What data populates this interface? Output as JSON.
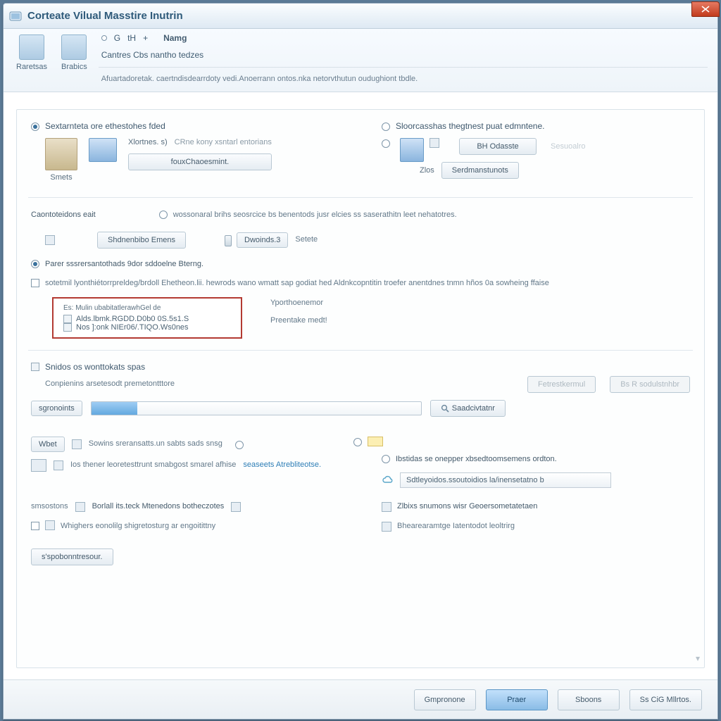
{
  "window": {
    "title": "Corteate Vilual Masstire Inutrin"
  },
  "close_btn_icon": "close-icon",
  "ribbon": {
    "tab1_label": "Raretsas",
    "tab2_label": "Brabics",
    "mini_items": [
      "●",
      "G",
      "tH",
      "+"
    ],
    "right_heading": "Namg",
    "subhead": "Cantres   Cbs  nantho tedzes",
    "desc": "Afuartadoretak. caertndisdearrdoty vedi.Anoerrann ontos.nka netorvthutun oudughiont tbdle."
  },
  "section1": {
    "left_radio": "Sextarnteta ore ethestohes fded",
    "right_radio": "Sloorcasshas thegtnest puat edmntene.",
    "left_field1": "Xlortnes. s)",
    "left_field1_hint": "CRne kony xsntarl entorians",
    "left_button": "fouxChaoesmint.",
    "left_small_label": "Smets",
    "right_label1": "BH Odasste",
    "right_label2": "Serdmanstunots",
    "right_zlabel": "Zlos",
    "right_side_grey": "Sesuoalro"
  },
  "section2": {
    "heading": "Caontoteidons eait",
    "radio_text": "wossonaral brihs seosrcice bs benentods jusr elcies ss saserathitn leet nehatotres.",
    "button_label": "Shdnenbibo Emens",
    "slider_value_label": "Dwoinds.3",
    "slider_after": "Setete",
    "blue_radio_text": "Parer sssrersantothads 9dor sddoelne Bterng.",
    "checkbox_text": "sotetmil lyonthiétorrpreldeg/brdoll Ehetheon.lii. hewrods wano wmatt sap godiat hed Aldnkcopntitin troefer anentdnes tnmn hños 0a sowheing ffaise",
    "redbox": {
      "title": "Es: Mulin ubabitatlerawhGel de",
      "line1": "Alds.lbmk.RGDD.D0b0 0S.5s1.S",
      "line2": "Nos ]:onk NIEr06/.TIQO.Ws0nes"
    },
    "aside_label1": "Yporthoenemor",
    "aside_label2": "Preentake medt!"
  },
  "section3": {
    "header": "Snidos os wonttokats spas",
    "sub": "Conpienins  arsetesodt premetontttore",
    "left_btn": "sgronoints",
    "right_btn": "Saadcivtatnr",
    "ghost_btn1": "Fetrestkermul",
    "ghost_btn2": "Bs R sodulstnhbr"
  },
  "section4": {
    "right_radio": "Ibstidas se onepper xbsedtoomsemens ordton.",
    "right_box_text": "Sdtleyoidos.ssoutoidios la/inensetatno b",
    "left_row1_btn": "Wbet",
    "left_row1_text": "Sowins sreransatts.un sabts sads snsg",
    "left_row2_text": "Ios thener leoretesttrunt smabgost smarel afhise",
    "left_row2_link": "seaseets Atrebliteotse.",
    "bottom_left_label": "smsostons",
    "bottom_left_text1": "Borlall its.teck   Mtenedons botheczotes",
    "bottom_left_text2": "Whighers eonolilg shigretosturg ar engoitittny",
    "bottom_right_text1": "Zlbixs snumons   wisr     Geoersometatetaen",
    "bottom_right_text2": "Bhearearamtge Iatentodot leoltrirg",
    "final_button": "s'spobonntresour."
  },
  "footer": {
    "b1": "Gmpronone",
    "b2": "Praer",
    "b3": "Sboons",
    "b4": "Ss CiG Mllrtos."
  }
}
